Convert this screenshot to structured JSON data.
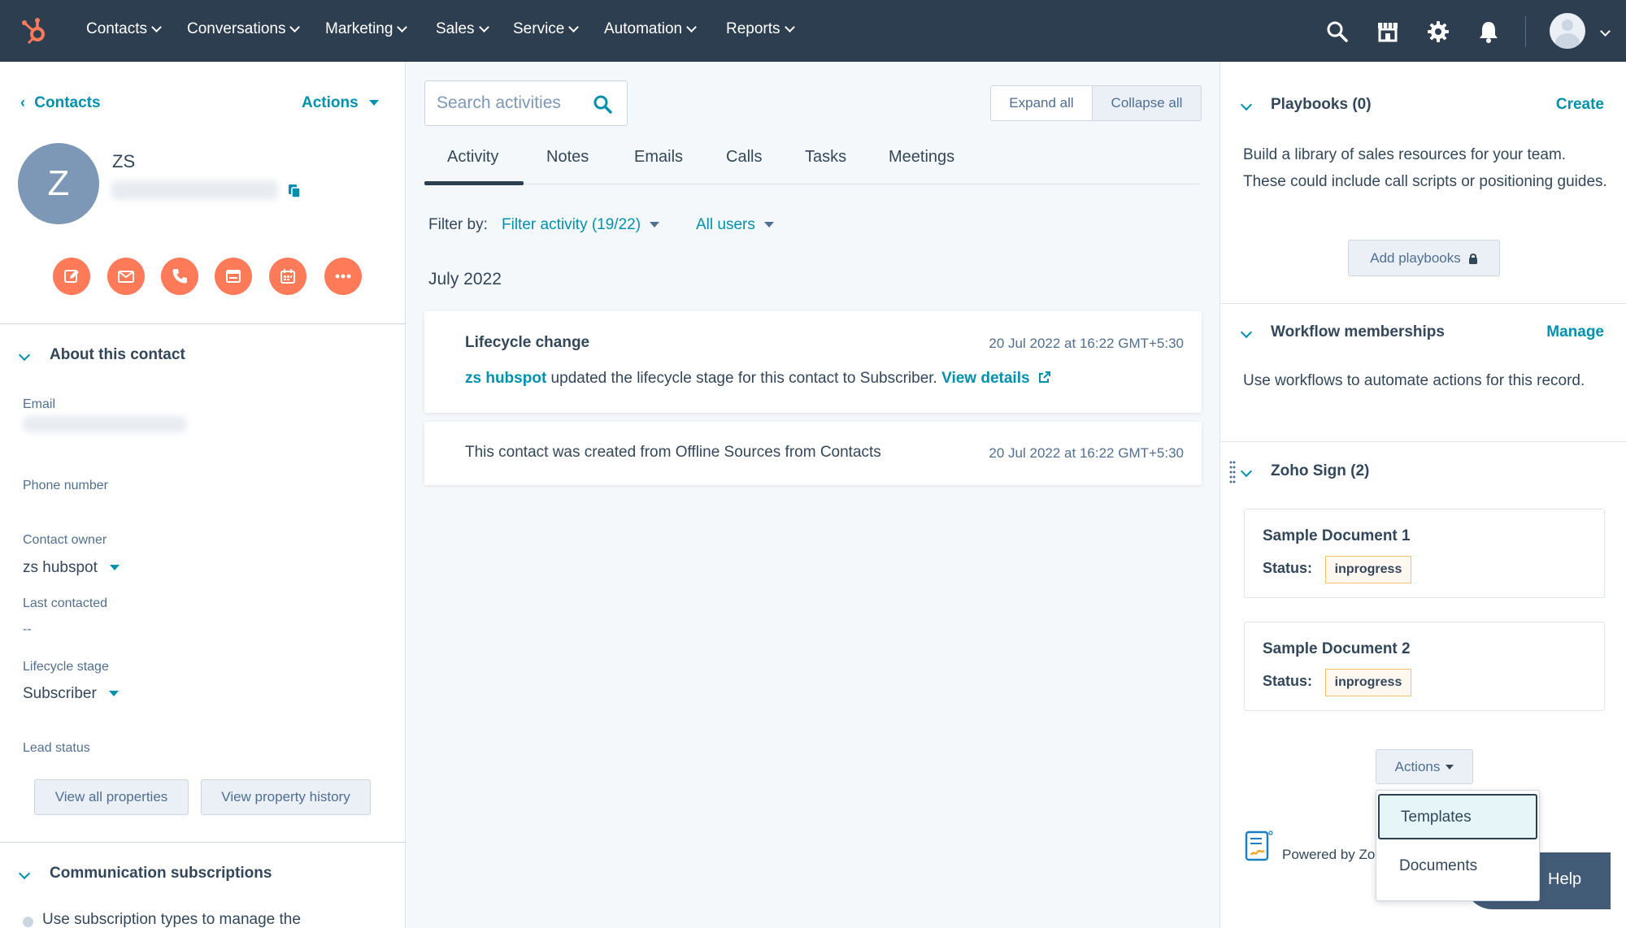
{
  "topnav": {
    "items": [
      "Contacts",
      "Conversations",
      "Marketing",
      "Sales",
      "Service",
      "Automation",
      "Reports"
    ]
  },
  "left": {
    "back_link": "Contacts",
    "actions_label": "Actions",
    "avatar_initial": "Z",
    "contact_name": "ZS",
    "about_heading": "About this contact",
    "email_label": "Email",
    "phone_label": "Phone number",
    "owner_label": "Contact owner",
    "owner_value": "zs hubspot",
    "last_contacted_label": "Last contacted",
    "last_contacted_value": "--",
    "lifecycle_label": "Lifecycle stage",
    "lifecycle_value": "Subscriber",
    "lead_status_label": "Lead status",
    "view_all_btn": "View all properties",
    "view_history_btn": "View property history",
    "comm_heading": "Communication subscriptions",
    "comm_text": "Use subscription types to manage the"
  },
  "middle": {
    "search_placeholder": "Search activities",
    "expand_all": "Expand all",
    "collapse_all": "Collapse all",
    "tabs": [
      "Activity",
      "Notes",
      "Emails",
      "Calls",
      "Tasks",
      "Meetings"
    ],
    "filter_by_label": "Filter by:",
    "filter_activity": "Filter activity (19/22)",
    "all_users": "All users",
    "month_heading": "July 2022",
    "card1": {
      "title": "Lifecycle change",
      "timestamp": "20 Jul 2022 at 16:22 GMT+5:30",
      "actor": "zs hubspot",
      "text": " updated the lifecycle stage for this contact to Subscriber. ",
      "link": "View details"
    },
    "card2": {
      "text": "This contact was created from Offline Sources from Contacts",
      "timestamp": "20 Jul 2022 at 16:22 GMT+5:30"
    }
  },
  "right": {
    "playbooks_title": "Playbooks (0)",
    "playbooks_create": "Create",
    "playbooks_desc": "Build a library of sales resources for your team. These could include call scripts or positioning guides.",
    "add_playbooks": "Add playbooks",
    "workflow_title": "Workflow memberships",
    "workflow_manage": "Manage",
    "workflow_desc": "Use workflows to automate actions for this record.",
    "zoho_title": "Zoho Sign (2)",
    "docs": [
      {
        "name": "Sample Document 1",
        "status_label": "Status:",
        "status": "inprogress"
      },
      {
        "name": "Sample Document 2",
        "status_label": "Status:",
        "status": "inprogress"
      }
    ],
    "actions_btn": "Actions",
    "dropdown": [
      "Templates",
      "Documents"
    ],
    "powered_by": "Powered by Zo",
    "help": "Help"
  },
  "colors": {
    "nav_bg": "#2d3e50",
    "accent": "#0091ae",
    "brand_orange": "#ff7a59",
    "avatar": "#7c98b6",
    "badge_border": "#f5c26b"
  }
}
